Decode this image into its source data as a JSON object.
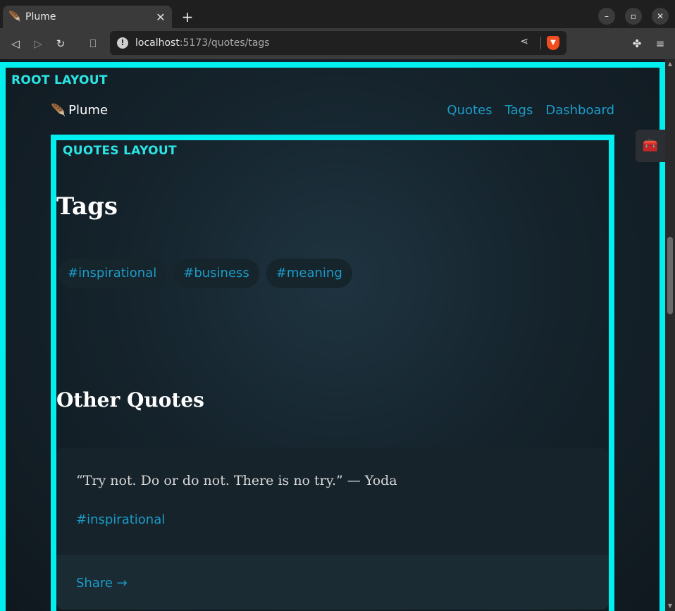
{
  "browser": {
    "tab_title": "Plume",
    "tab_favicon": "🪶",
    "url_host": "localhost",
    "url_path": ":5173/quotes/tags"
  },
  "page": {
    "root_label": "ROOT LAYOUT",
    "brand": "Plume",
    "brand_icon": "🪶",
    "nav": [
      "Quotes",
      "Tags",
      "Dashboard"
    ],
    "quotes_label": "QUOTES LAYOUT",
    "tags_heading": "Tags",
    "tags": [
      "#inspirational",
      "#business",
      "#meaning"
    ],
    "other_heading": "Other Quotes",
    "quote": {
      "text": "“Try not. Do or do not. There is no try.” — Yoda",
      "tag": "#inspirational",
      "share": "Share →"
    }
  },
  "colors": {
    "accent": "#1b9cc8",
    "outline": "#00f0f0"
  }
}
